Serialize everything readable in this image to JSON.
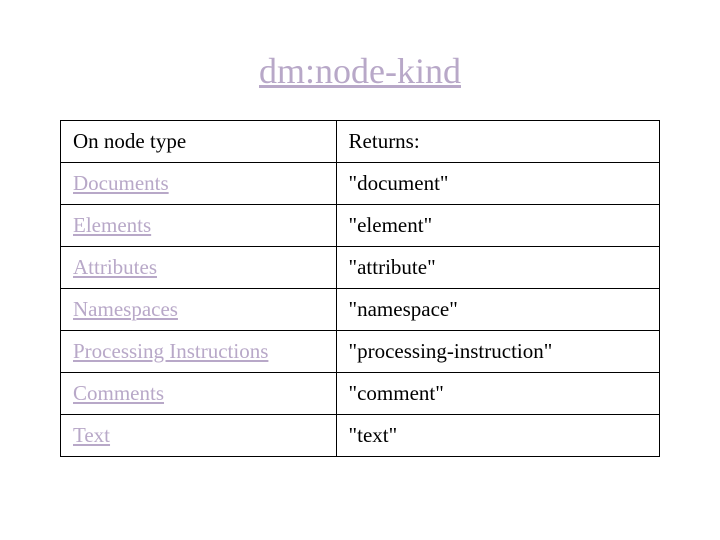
{
  "title": "dm:node-kind",
  "table": {
    "headers": {
      "col1": "On node type",
      "col2": "Returns:"
    },
    "rows": [
      {
        "node_type": "Documents",
        "returns": "\"document\""
      },
      {
        "node_type": "Elements",
        "returns": "\"element\""
      },
      {
        "node_type": "Attributes",
        "returns": "\"attribute\""
      },
      {
        "node_type": "Namespaces",
        "returns": "\"namespace\""
      },
      {
        "node_type": "Processing Instructions",
        "returns": "\"processing-instruction\""
      },
      {
        "node_type": "Comments",
        "returns": "\"comment\""
      },
      {
        "node_type": "Text",
        "returns": "\"text\""
      }
    ]
  }
}
